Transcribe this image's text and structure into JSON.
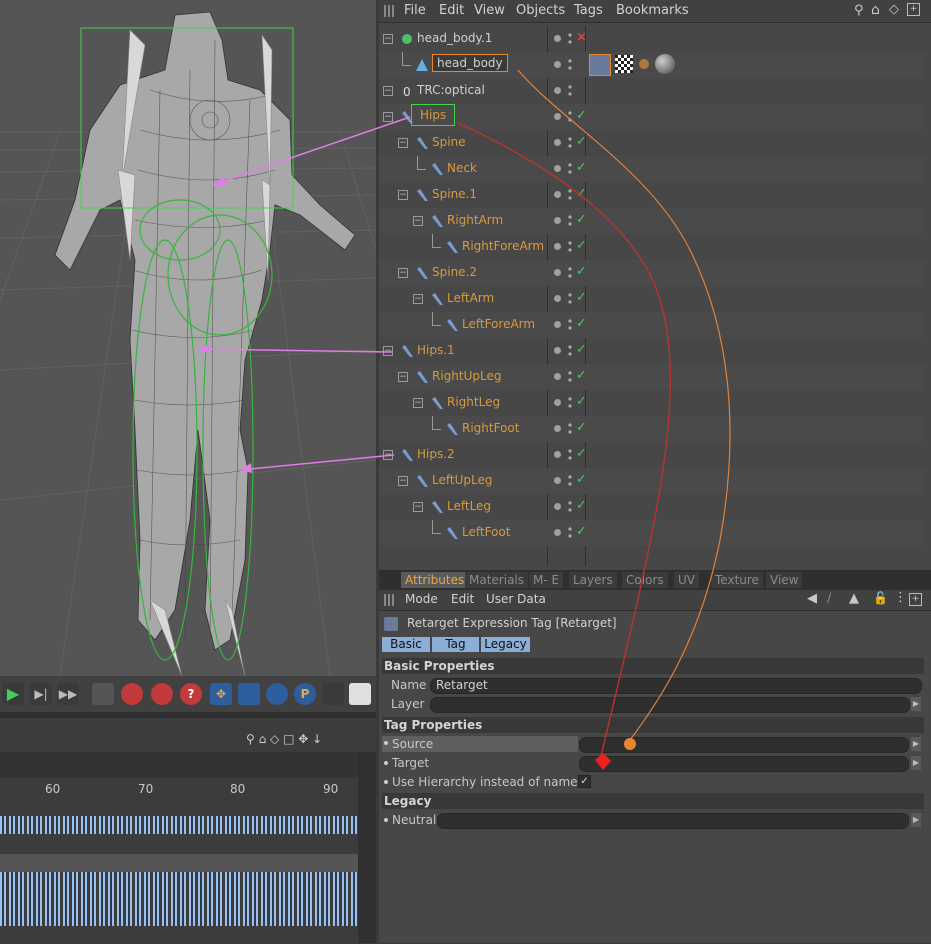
{
  "object_manager": {
    "menu": [
      "File",
      "Edit",
      "View",
      "Objects",
      "Tags",
      "Bookmarks"
    ],
    "objects": [
      {
        "name": "head_body.1",
        "kind": "obj",
        "indent": 0,
        "icon": "null-object-icon",
        "x_mark": true
      },
      {
        "name": "head_body",
        "kind": "obj",
        "indent": 1,
        "icon": "polygon-object-icon",
        "selected_box": true
      },
      {
        "name": "TRC:optical",
        "kind": "obj",
        "indent": 0,
        "icon": "null-zero-icon"
      },
      {
        "name": "Hips",
        "kind": "bone",
        "indent": 0,
        "icon": "joint-icon",
        "green_box": true
      },
      {
        "name": "Spine",
        "kind": "bone",
        "indent": 1,
        "icon": "joint-icon"
      },
      {
        "name": "Neck",
        "kind": "bone",
        "indent": 2,
        "icon": "joint-icon"
      },
      {
        "name": "Spine.1",
        "kind": "bone",
        "indent": 1,
        "icon": "joint-icon"
      },
      {
        "name": "RightArm",
        "kind": "bone",
        "indent": 2,
        "icon": "joint-icon"
      },
      {
        "name": "RightForeArm",
        "kind": "bone",
        "indent": 3,
        "icon": "joint-icon"
      },
      {
        "name": "Spine.2",
        "kind": "bone",
        "indent": 1,
        "icon": "joint-icon"
      },
      {
        "name": "LeftArm",
        "kind": "bone",
        "indent": 2,
        "icon": "joint-icon"
      },
      {
        "name": "LeftForeArm",
        "kind": "bone",
        "indent": 3,
        "icon": "joint-icon"
      },
      {
        "name": "Hips.1",
        "kind": "bone",
        "indent": 0,
        "icon": "joint-icon"
      },
      {
        "name": "RightUpLeg",
        "kind": "bone",
        "indent": 1,
        "icon": "joint-icon"
      },
      {
        "name": "RightLeg",
        "kind": "bone",
        "indent": 2,
        "icon": "joint-icon"
      },
      {
        "name": "RightFoot",
        "kind": "bone",
        "indent": 3,
        "icon": "joint-icon"
      },
      {
        "name": "Hips.2",
        "kind": "bone",
        "indent": 0,
        "icon": "joint-icon"
      },
      {
        "name": "LeftUpLeg",
        "kind": "bone",
        "indent": 1,
        "icon": "joint-icon"
      },
      {
        "name": "LeftLeg",
        "kind": "bone",
        "indent": 2,
        "icon": "joint-icon"
      },
      {
        "name": "LeftFoot",
        "kind": "bone",
        "indent": 3,
        "icon": "joint-icon"
      }
    ]
  },
  "tabs": [
    "Attributes",
    "Materials",
    "M- E",
    "Layers",
    "Colors",
    "UV",
    "Texture",
    "View"
  ],
  "attributes": {
    "menu": [
      "Mode",
      "Edit",
      "User Data"
    ],
    "tag_title": "Retarget Expression Tag [Retarget]",
    "subtabs": [
      "Basic",
      "Tag",
      "Legacy"
    ],
    "sections": {
      "basic": "Basic Properties",
      "tag": "Tag Properties",
      "legacy": "Legacy"
    },
    "fields": {
      "name_label": "Name",
      "name_value": "Retarget",
      "layer_label": "Layer",
      "source_label": "Source",
      "target_label": "Target",
      "use_hierarchy_label": "Use Hierarchy instead of names",
      "neutral_label": "Neutral"
    }
  },
  "timeline": {
    "ticks": [
      "60",
      "70",
      "80",
      "90"
    ]
  },
  "colors": {
    "bone_text": "#d99a3e",
    "check_green": "#3fcf5a",
    "active_tab": "#e6a94a",
    "subtab_blue": "#8aaed6"
  }
}
